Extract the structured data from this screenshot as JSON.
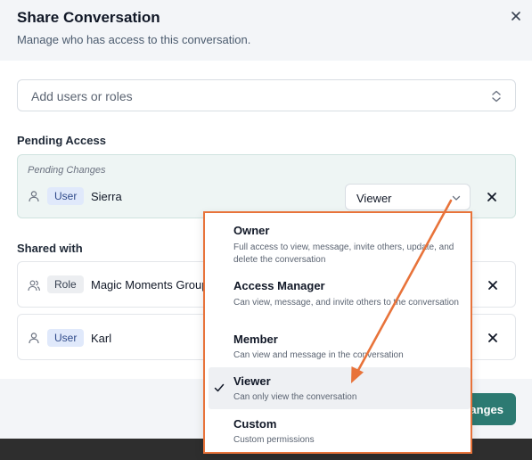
{
  "dialog": {
    "title": "Share Conversation",
    "subtitle": "Manage who has access to this conversation."
  },
  "add_field": {
    "placeholder": "Add users or roles"
  },
  "pending": {
    "section_label": "Pending Access",
    "caption": "Pending Changes",
    "entry": {
      "type": "User",
      "name": "Sierra",
      "role": "Viewer"
    }
  },
  "shared": {
    "section_label": "Shared with",
    "entries": [
      {
        "type": "Role",
        "name": "Magic Moments Group"
      },
      {
        "type": "User",
        "name": "Karl"
      }
    ]
  },
  "footer": {
    "save_label": "Save Changes"
  },
  "role_menu": {
    "selected": "Viewer",
    "options": [
      {
        "title": "Owner",
        "description": "Full access to view, message, invite others, update, and delete the conversation"
      },
      {
        "title": "Access Manager",
        "description": "Can view, message, and invite others to the conversation"
      },
      {
        "title": "Member",
        "description": "Can view and message in the conversation"
      },
      {
        "title": "Viewer",
        "description": "Can only view the conversation"
      },
      {
        "title": "Custom",
        "description": "Custom permissions"
      }
    ]
  },
  "colors": {
    "accent": "#2c7a72",
    "annotation": "#e8733a",
    "pending_bg": "#eef5f4"
  },
  "icons": [
    "close-icon",
    "chevron-updown-icon",
    "person-icon",
    "group-icon",
    "chevron-down-icon",
    "check-icon",
    "remove-icon"
  ]
}
